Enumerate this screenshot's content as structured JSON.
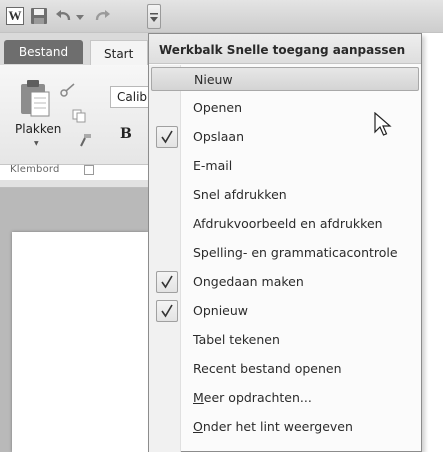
{
  "titlebar": {
    "app_icon_letter": "W"
  },
  "ribbon": {
    "tabs": [
      {
        "label": "Bestand"
      },
      {
        "label": "Start"
      }
    ],
    "clipboard": {
      "paste_label": "Plakken",
      "group_label": "Klembord"
    },
    "font": {
      "name": "Calib",
      "bold_label": "B"
    }
  },
  "menu": {
    "title": "Werkbalk Snelle toegang aanpassen",
    "items": [
      {
        "label": "Nieuw",
        "checked": false,
        "highlighted": true
      },
      {
        "label": "Openen",
        "checked": false
      },
      {
        "label": "Opslaan",
        "checked": true
      },
      {
        "label": "E-mail",
        "checked": false
      },
      {
        "label": "Snel afdrukken",
        "checked": false
      },
      {
        "label": "Afdrukvoorbeeld en afdrukken",
        "checked": false
      },
      {
        "label": "Spelling- en grammaticacontrole",
        "checked": false
      },
      {
        "label": "Ongedaan maken",
        "checked": true
      },
      {
        "label": "Opnieuw",
        "checked": true
      },
      {
        "label": "Tabel tekenen",
        "checked": false
      },
      {
        "label": "Recent bestand openen",
        "checked": false
      },
      {
        "label": "Meer opdrachten...",
        "checked": false
      },
      {
        "label": "Onder het lint weergeven",
        "checked": false
      }
    ]
  },
  "icons": {
    "app": "word-app-icon",
    "save": "save-icon",
    "undo": "undo-icon",
    "redo": "redo-icon",
    "customize": "customize-toolbar-icon",
    "check": "checkmark-icon",
    "cursor": "mouse-pointer-icon"
  }
}
